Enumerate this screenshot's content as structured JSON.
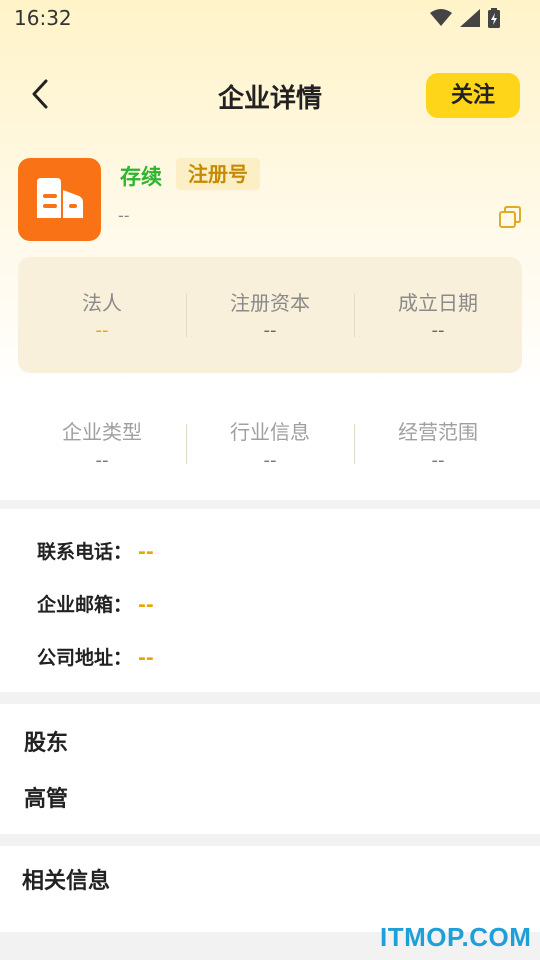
{
  "status_bar": {
    "time": "16:32",
    "icons": [
      "wifi-icon",
      "signal-icon",
      "battery-charging-icon"
    ]
  },
  "header": {
    "title": "企业详情",
    "follow_label": "关注",
    "back_icon": "chevron-left-icon"
  },
  "company": {
    "logo_icon": "building-icon",
    "logo_color": "#f97316",
    "status": "存续",
    "status_color": "#2db52d",
    "reg_label": "注册号",
    "reg_value": "--",
    "copy_icon": "copy-icon"
  },
  "summary": [
    {
      "label": "法人",
      "value": "--"
    },
    {
      "label": "注册资本",
      "value": "--"
    },
    {
      "label": "成立日期",
      "value": "--"
    }
  ],
  "types": [
    {
      "label": "企业类型",
      "value": "--"
    },
    {
      "label": "行业信息",
      "value": "--"
    },
    {
      "label": "经营范围",
      "value": "--"
    }
  ],
  "contact": [
    {
      "label": "联系电话：",
      "value": "--"
    },
    {
      "label": "企业邮箱：",
      "value": "--"
    },
    {
      "label": "公司地址：",
      "value": "--"
    }
  ],
  "people": [
    "股东",
    "高管"
  ],
  "related": {
    "title": "相关信息"
  },
  "watermark": "ITMOP.COM",
  "colors": {
    "accent": "#ffd51a",
    "value_yellow": "#e5a800"
  }
}
